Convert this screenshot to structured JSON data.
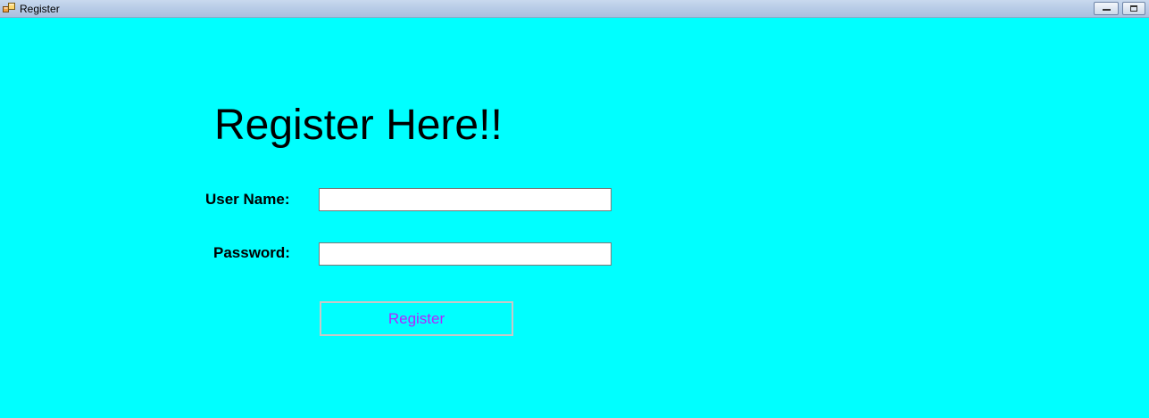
{
  "window": {
    "title": "Register",
    "icon": "form-window-icon",
    "background_color": "#00ffff"
  },
  "titlebar": {
    "minimize_icon": "minimize-icon",
    "restore_icon": "restore-icon"
  },
  "form": {
    "heading": "Register Here!!",
    "username_label": "User Name:",
    "username_value": "",
    "password_label": "Password:",
    "password_value": "",
    "register_button_label": "Register",
    "register_button_text_color": "#b026ff"
  }
}
